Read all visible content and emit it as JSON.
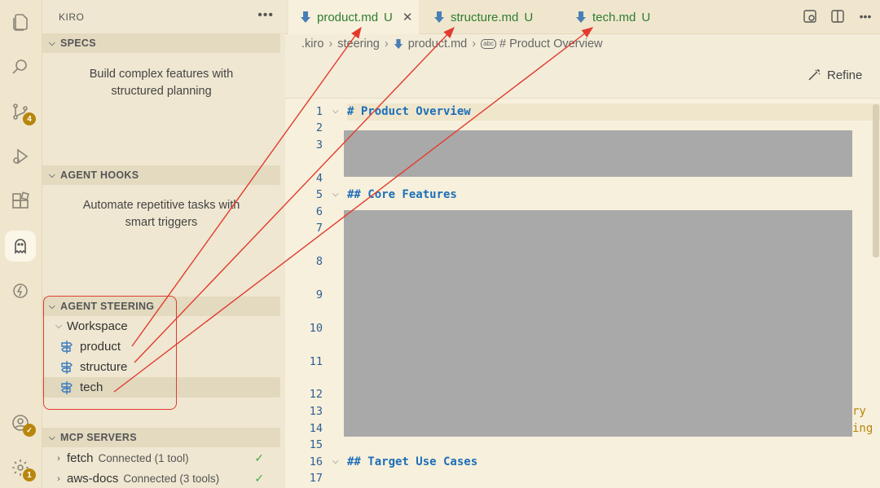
{
  "sidebar": {
    "title": "KIRO",
    "more": "•••",
    "specs": {
      "header": "SPECS",
      "description_line1": "Build complex features with",
      "description_line2": "structured planning"
    },
    "hooks": {
      "header": "AGENT HOOKS",
      "description_line1": "Automate repetitive tasks with",
      "description_line2": "smart triggers"
    },
    "steering": {
      "header": "AGENT STEERING",
      "workspace": "Workspace",
      "items": [
        {
          "label": "product"
        },
        {
          "label": "structure"
        },
        {
          "label": "tech"
        }
      ]
    },
    "mcp": {
      "header": "MCP SERVERS",
      "servers": [
        {
          "name": "fetch",
          "status": "Connected (1 tool)"
        },
        {
          "name": "aws-docs",
          "status": "Connected (3 tools)"
        }
      ]
    }
  },
  "activity": {
    "source_control_badge": "4",
    "settings_badge": "1"
  },
  "tabs": [
    {
      "name": "product.md",
      "status": "U",
      "active": true
    },
    {
      "name": "structure.md",
      "status": "U",
      "active": false
    },
    {
      "name": "tech.md",
      "status": "U",
      "active": false
    }
  ],
  "breadcrumb": {
    "root": ".kiro",
    "folder": "steering",
    "file": "product.md",
    "symbol": "# Product Overview",
    "symbol_icon": "abc"
  },
  "refine_label": "Refine",
  "editor": {
    "line_numbers": [
      "1",
      "2",
      "3",
      "4",
      "5",
      "6",
      "7",
      "8",
      "9",
      "10",
      "11",
      "12",
      "13",
      "14",
      "15",
      "16",
      "17"
    ],
    "lines": {
      "l1": "# Product Overview",
      "l5": "## Core Features",
      "l16": "## Target Use Cases"
    },
    "clipped_right_13": "ry",
    "clipped_right_14": "ing"
  },
  "colors": {
    "accent": "#1d6fb8",
    "annotation": "#e23b2e",
    "untracked": "#2e7d32"
  }
}
